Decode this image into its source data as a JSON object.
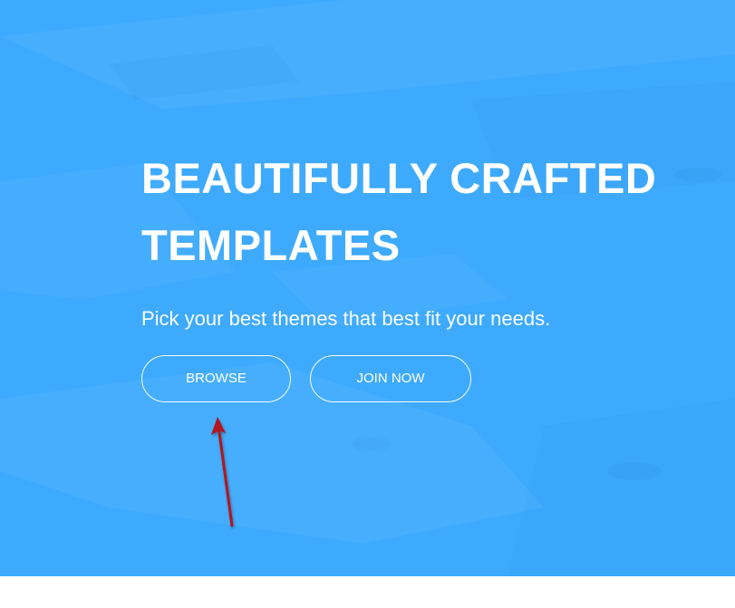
{
  "hero": {
    "title_line1": "BEAUTIFULLY CRAFTED",
    "title_line2": "TEMPLATES",
    "subtitle": "Pick your best themes that best fit your needs.",
    "background_color": "#3eaafd"
  },
  "buttons": {
    "browse_label": "BROWSE",
    "join_label": "JOIN NOW"
  },
  "annotation": {
    "arrow_color": "#b3131d",
    "icon": "arrow-up-icon"
  }
}
